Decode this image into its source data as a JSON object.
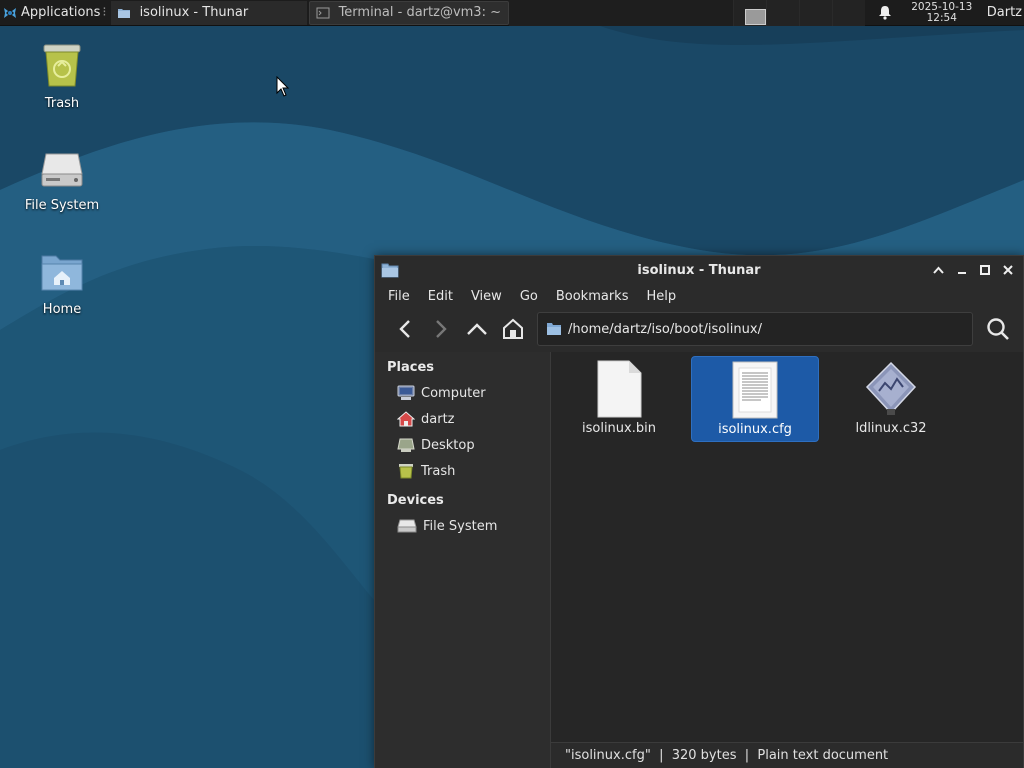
{
  "panel": {
    "applications_label": "Applications",
    "applications_separator": "⁝",
    "tasks": [
      {
        "label": "isolinux - Thunar"
      },
      {
        "label": "Terminal - dartz@vm3: ~"
      }
    ],
    "clock_date": "2025-10-13",
    "clock_time": "12:54",
    "user": "Dartz"
  },
  "desktop": {
    "icons": [
      {
        "label": "Trash",
        "icon": "trash-icon"
      },
      {
        "label": "File System",
        "icon": "drive-icon"
      },
      {
        "label": "Home",
        "icon": "home-folder-icon"
      }
    ]
  },
  "window": {
    "title": "isolinux - Thunar",
    "menu": [
      "File",
      "Edit",
      "View",
      "Go",
      "Bookmarks",
      "Help"
    ],
    "path": "/home/dartz/iso/boot/isolinux/",
    "sidebar": {
      "places_header": "Places",
      "places": [
        {
          "label": "Computer",
          "icon": "computer-icon"
        },
        {
          "label": "dartz",
          "icon": "user-home-icon"
        },
        {
          "label": "Desktop",
          "icon": "desktop-icon"
        },
        {
          "label": "Trash",
          "icon": "trash-icon"
        }
      ],
      "devices_header": "Devices",
      "devices": [
        {
          "label": "File System",
          "icon": "drive-icon"
        }
      ]
    },
    "files": [
      {
        "name": "isolinux.bin",
        "icon": "binary-file-icon",
        "selected": false
      },
      {
        "name": "isolinux.cfg",
        "icon": "text-file-icon",
        "selected": true
      },
      {
        "name": "ldlinux.c32",
        "icon": "executable-file-icon",
        "selected": false
      }
    ],
    "status": "\"isolinux.cfg\"  |  320 bytes  |  Plain text document"
  },
  "colors": {
    "selection": "#1d5aa7",
    "desktop_bg": "#1f5577",
    "panel_bg": "#1c1c1c",
    "window_bg": "#2b2b2b"
  }
}
